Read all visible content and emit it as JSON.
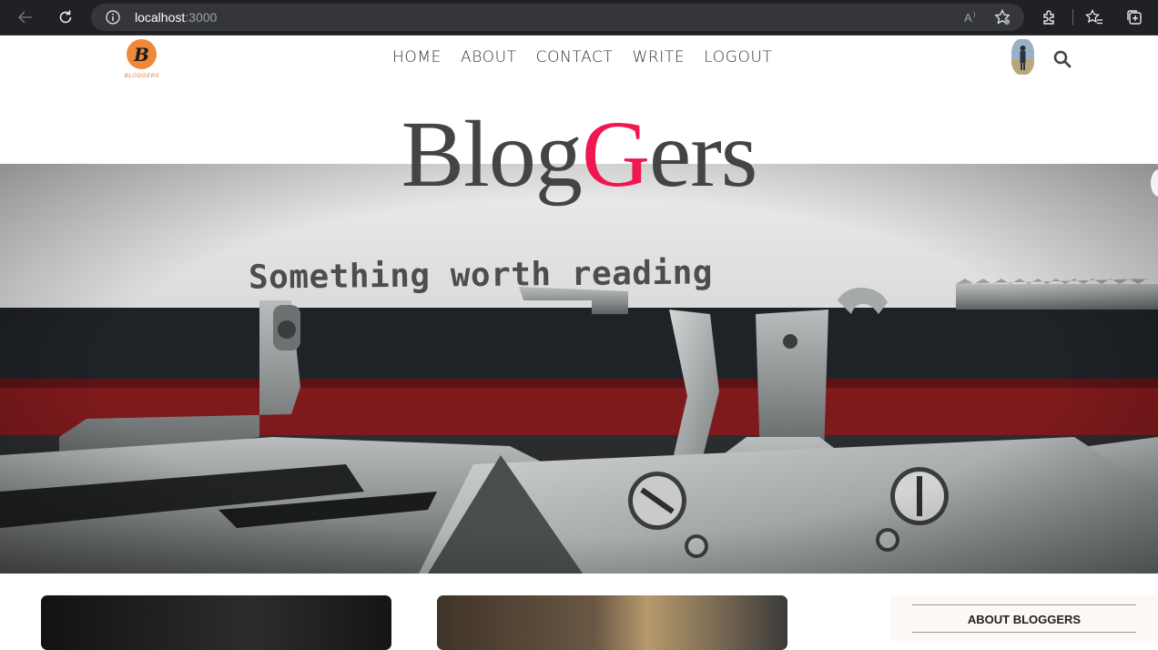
{
  "browser": {
    "url_host": "localhost",
    "url_port": ":3000",
    "icons": [
      "back-arrow-icon",
      "refresh-icon",
      "info-icon",
      "read-aloud-icon",
      "favorite-star-icon",
      "extensions-icon",
      "favorites-icon",
      "collections-icon"
    ]
  },
  "header": {
    "logo_letter": "B",
    "logo_text": "BLOGGERS",
    "nav": [
      "HOME",
      "ABOUT",
      "CONTACT",
      "WRITE",
      "LOGOUT"
    ]
  },
  "hero": {
    "title_before": "Blog",
    "title_accent": "G",
    "title_after": "ers",
    "image_caption_text": "Something worth reading",
    "accent_color": "#f0164f"
  },
  "sidebar": {
    "title": "ABOUT BLOGGERS"
  }
}
